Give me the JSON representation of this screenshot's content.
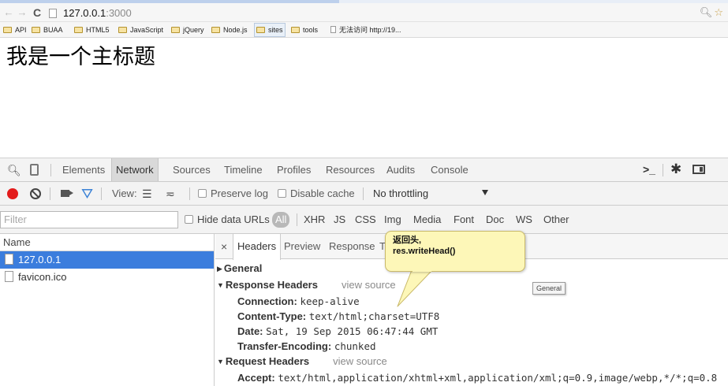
{
  "browser": {
    "url_host": "127.0.0.1",
    "url_port": ":3000",
    "zoom_icon": "magnifier-icon",
    "star_icon": "star-icon",
    "bookmarks": [
      "API",
      "BUAA",
      "HTML5",
      "JavaScript",
      "jQuery",
      "Node.js",
      "sites",
      "tools",
      "无法访问 http://19..."
    ]
  },
  "page": {
    "heading": "我是一个主标题"
  },
  "devtools": {
    "tabs": [
      "Elements",
      "Network",
      "Sources",
      "Timeline",
      "Profiles",
      "Resources",
      "Audits",
      "Console"
    ],
    "toolbar": {
      "view_label": "View:",
      "preserve_log": "Preserve log",
      "disable_cache": "Disable cache",
      "throttling": "No throttling"
    },
    "filter": {
      "placeholder": "Filter",
      "hide_data_urls": "Hide data URLs",
      "all": "All",
      "types": [
        "XHR",
        "JS",
        "CSS",
        "Img",
        "Media",
        "Font",
        "Doc",
        "WS",
        "Other"
      ]
    },
    "name_column": "Name",
    "requests": [
      "127.0.0.1",
      "favicon.ico"
    ],
    "detail_tabs": [
      "Headers",
      "Preview",
      "Response",
      "T"
    ],
    "close": "×",
    "general_section": "General",
    "response_section": "Response Headers",
    "request_section": "Request Headers",
    "view_source": "view source",
    "response_headers": [
      {
        "key": "Connection:",
        "value": "keep-alive"
      },
      {
        "key": "Content-Type:",
        "value": "text/html;charset=UTF8"
      },
      {
        "key": "Date:",
        "value": "Sat, 19 Sep 2015 06:47:44 GMT"
      },
      {
        "key": "Transfer-Encoding:",
        "value": "chunked"
      }
    ],
    "request_headers": [
      {
        "key": "Accept:",
        "value": "text/html,application/xhtml+xml,application/xml;q=0.9,image/webp,*/*;q=0.8"
      }
    ],
    "general_tooltip": "General"
  },
  "callout": {
    "line1": "返回头,",
    "line2": "res.writeHead()"
  },
  "colors": {
    "record": "#e31b1b",
    "selected_row": "#3b7ddd",
    "callout_bg": "#fdf7b8"
  }
}
